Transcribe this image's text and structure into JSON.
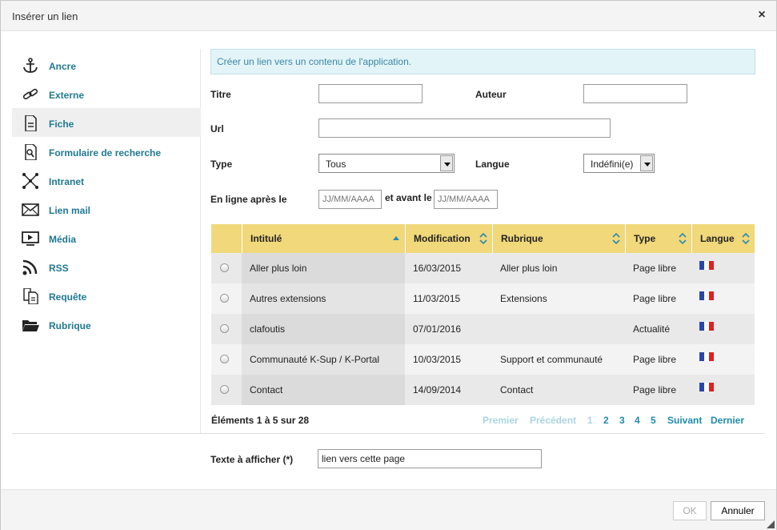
{
  "dialog": {
    "title": "Insérer un lien",
    "close_glyph": "×"
  },
  "sidebar": {
    "items": [
      {
        "label": "Ancre",
        "icon": "anchor-icon"
      },
      {
        "label": "Externe",
        "icon": "link-icon"
      },
      {
        "label": "Fiche",
        "icon": "document-icon",
        "active": true
      },
      {
        "label": "Formulaire de recherche",
        "icon": "search-document-icon"
      },
      {
        "label": "Intranet",
        "icon": "network-icon"
      },
      {
        "label": "Lien mail",
        "icon": "mail-icon"
      },
      {
        "label": "Média",
        "icon": "media-screen-icon"
      },
      {
        "label": "RSS",
        "icon": "rss-icon"
      },
      {
        "label": "Requête",
        "icon": "query-document-icon"
      },
      {
        "label": "Rubrique",
        "icon": "folder-icon"
      }
    ]
  },
  "info": "Créer un lien vers un contenu de l'application.",
  "form": {
    "titre_label": "Titre",
    "titre_value": "",
    "auteur_label": "Auteur",
    "auteur_value": "",
    "url_label": "Url",
    "url_value": "",
    "type_label": "Type",
    "type_value": "Tous",
    "langue_label": "Langue",
    "langue_value": "Indéfini(e)",
    "online_after_label": "En ligne après le",
    "online_after_placeholder": "JJ/MM/AAAA",
    "before_label": "et avant le",
    "before_placeholder": "JJ/MM/AAAA"
  },
  "table": {
    "headers": [
      "Intitulé",
      "Modification",
      "Rubrique",
      "Type",
      "Langue"
    ],
    "rows": [
      {
        "intitule": "Aller plus loin",
        "modification": "16/03/2015",
        "rubrique": "Aller plus loin",
        "type": "Page libre",
        "langue": "fr"
      },
      {
        "intitule": "Autres extensions",
        "modification": "11/03/2015",
        "rubrique": "Extensions",
        "type": "Page libre",
        "langue": "fr"
      },
      {
        "intitule": "clafoutis",
        "modification": "07/01/2016",
        "rubrique": "",
        "type": "Actualité",
        "langue": "fr"
      },
      {
        "intitule": "Communauté K-Sup / K-Portal",
        "modification": "10/03/2015",
        "rubrique": "Support et communauté",
        "type": "Page libre",
        "langue": "fr"
      },
      {
        "intitule": "Contact",
        "modification": "14/09/2014",
        "rubrique": "Contact",
        "type": "Page libre",
        "langue": "fr"
      }
    ],
    "flag_colors": [
      "#2a46a8",
      "#ffffff",
      "#e02020"
    ]
  },
  "pagination": {
    "count": "Éléments 1 à 5 sur 28",
    "first": "Premier",
    "previous": "Précédent",
    "pages": [
      "1",
      "2",
      "3",
      "4",
      "5"
    ],
    "next": "Suivant",
    "last": "Dernier"
  },
  "display_text": {
    "label": "Texte à afficher (*)",
    "value": "lien vers cette page"
  },
  "buttons": {
    "ok": "OK",
    "cancel": "Annuler"
  },
  "colors": {
    "accent_link": "#1f7893",
    "header_yellow": "#f0d87b",
    "info_bg": "#e3f4f9"
  }
}
